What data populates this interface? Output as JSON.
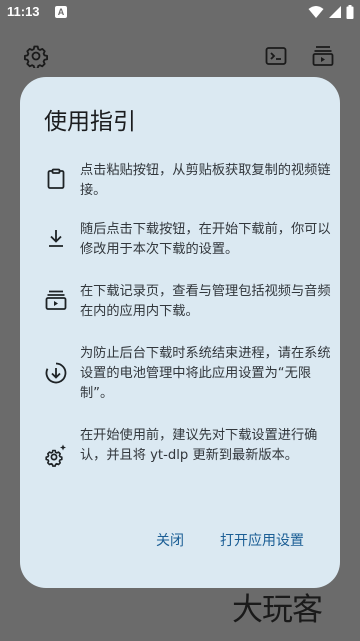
{
  "status_bar": {
    "time": "11:13",
    "notification_badge": "A"
  },
  "app_bar": {
    "icons": [
      "gear-icon",
      "terminal-icon",
      "download-queue-icon"
    ]
  },
  "dialog": {
    "title": "使用指引",
    "steps": [
      {
        "icon": "clipboard-icon",
        "text": "点击粘贴按钮，从剪贴板获取复制的视频链接。"
      },
      {
        "icon": "download-icon",
        "text": "随后点击下载按钮，在开始下载前，你可以修改用于本次下载的设置。"
      },
      {
        "icon": "playlist-icon",
        "text": "在下载记录页，查看与管理包括视频与音频在内的应用内下载。"
      },
      {
        "icon": "download-circle-icon",
        "text": "为防止后台下载时系统结束进程，请在系统设置的电池管理中将此应用设置为“无限制”。"
      },
      {
        "icon": "settings-sparkle-icon",
        "text": "在开始使用前，建议先对下载设置进行确认，并且将 yt-dlp 更新到最新版本。"
      }
    ],
    "close_label": "关闭",
    "open_settings_label": "打开应用设置"
  },
  "watermark": "大玩客",
  "colors": {
    "accent": "#1b5e95",
    "dialog_bg": "#dbe9f2",
    "scrim": "#6b6b6b"
  }
}
